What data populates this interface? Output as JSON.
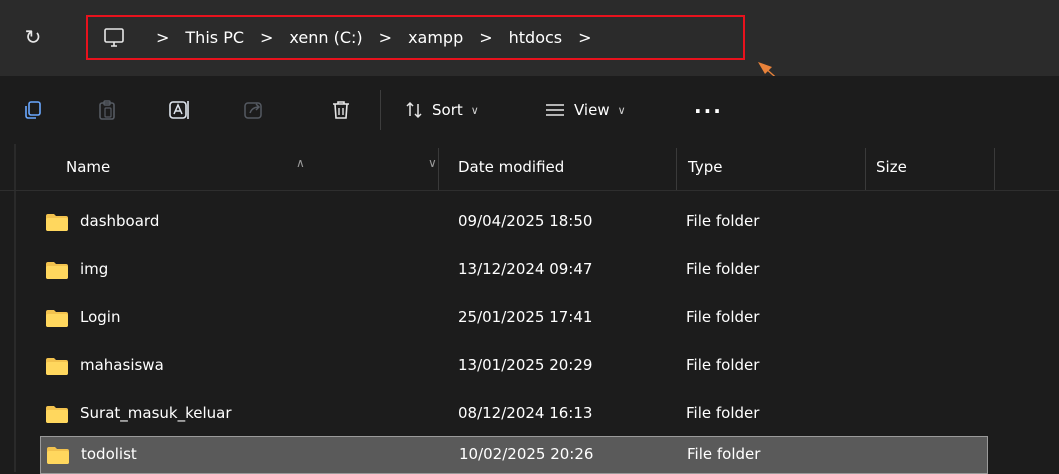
{
  "address_bar": {
    "breadcrumbs": [
      "This PC",
      "xenn (C:)",
      "xampp",
      "htdocs"
    ],
    "separator": ">",
    "highlight_color": "#e8121d",
    "annotation_arrow_color": "#e8823a"
  },
  "toolbar": {
    "sort_label": "Sort",
    "view_label": "View",
    "more_label": "..."
  },
  "columns": {
    "name": "Name",
    "date": "Date modified",
    "type": "Type",
    "size": "Size"
  },
  "rows": [
    {
      "name": "dashboard",
      "date": "09/04/2025 18:50",
      "type": "File folder",
      "size": ""
    },
    {
      "name": "img",
      "date": "13/12/2024 09:47",
      "type": "File folder",
      "size": ""
    },
    {
      "name": "Login",
      "date": "25/01/2025 17:41",
      "type": "File folder",
      "size": ""
    },
    {
      "name": "mahasiswa",
      "date": "13/01/2025 20:29",
      "type": "File folder",
      "size": ""
    },
    {
      "name": "Surat_masuk_keluar",
      "date": "08/12/2024 16:13",
      "type": "File folder",
      "size": ""
    },
    {
      "name": "todolist",
      "date": "10/02/2025 20:26",
      "type": "File folder",
      "size": ""
    }
  ],
  "selected_row": "todolist",
  "colors": {
    "background": "#1c1c1c",
    "folder": "#f2c24e",
    "selection": "#5a5a5a"
  }
}
